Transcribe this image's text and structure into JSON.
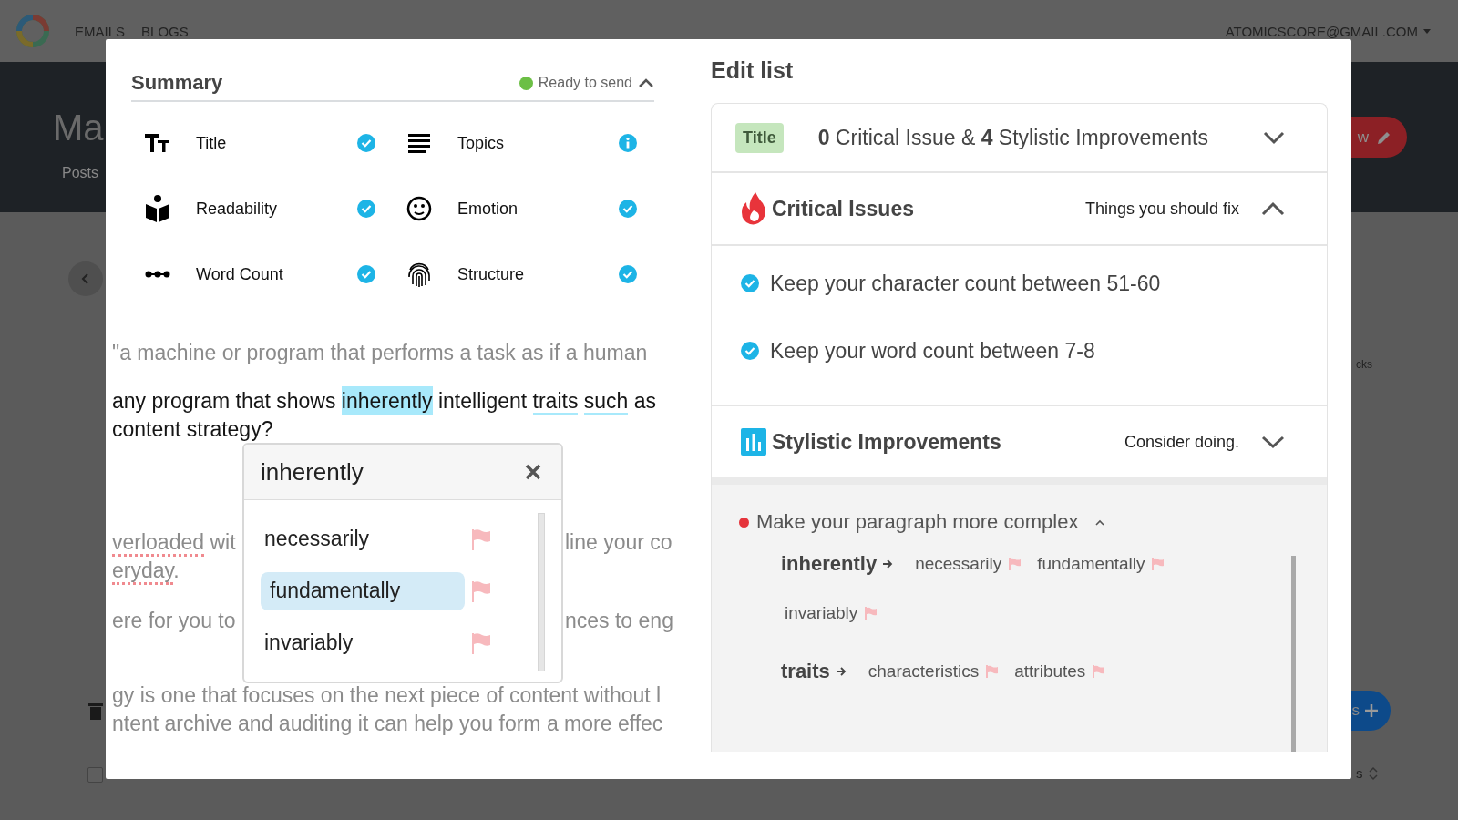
{
  "top_nav": {
    "links": [
      "EMAILS",
      "BLOGS"
    ],
    "account": "ATOMICSCORE@GMAIL.COM"
  },
  "background": {
    "page_title": "Ma",
    "tab": "Posts",
    "button_text": "w",
    "side_text": "cks",
    "add_button_text": "s",
    "table_text": "s",
    "row_checked": false
  },
  "summary": {
    "title": "Summary",
    "status": "Ready to send",
    "expanded": true,
    "items": [
      {
        "label": "Title",
        "kind": "check"
      },
      {
        "label": "Topics",
        "kind": "info"
      },
      {
        "label": "Readability",
        "kind": "check"
      },
      {
        "label": "Emotion",
        "kind": "check"
      },
      {
        "label": "Word Count",
        "kind": "check"
      },
      {
        "label": "Structure",
        "kind": "check"
      }
    ]
  },
  "editor": {
    "paragraphs": [
      {
        "dimmed": true,
        "lines": [
          {
            "parts": [
              {
                "text": "\"a machine or program that performs a task as if a human",
                "kind": "plain"
              }
            ]
          }
        ]
      },
      {
        "dimmed": false,
        "lines": [
          {
            "parts": [
              {
                "text": "any program that shows ",
                "kind": "plain"
              },
              {
                "text": "inherently",
                "kind": "highlight"
              },
              {
                "text": " intelligent ",
                "kind": "plain"
              },
              {
                "text": "traits",
                "kind": "underline"
              },
              {
                "text": "such",
                "kind": "underline"
              },
              {
                "text": " as",
                "kind": "plain"
              }
            ]
          },
          {
            "parts": [
              {
                "text": "content strategy?",
                "kind": "plain"
              }
            ]
          }
        ]
      },
      {
        "dimmed": true,
        "lines": [
          {
            "parts": [
              {
                "text": "verloaded",
                "kind": "dotted"
              },
              {
                "text": " wit",
                "kind": "plain"
              }
            ],
            "right": "line your co"
          },
          {
            "parts": [
              {
                "text": "eryday",
                "kind": "dotted"
              },
              {
                "text": ".",
                "kind": "plain"
              }
            ]
          }
        ]
      },
      {
        "dimmed": true,
        "lines": [
          {
            "parts": [
              {
                "text": "ere for you to",
                "kind": "plain"
              }
            ],
            "right": "nces to eng"
          }
        ]
      },
      {
        "dimmed": true,
        "lines": [
          {
            "parts": [
              {
                "text": "gy is one that focuses on the next piece of content without l",
                "kind": "plain"
              }
            ]
          },
          {
            "parts": [
              {
                "text": "ntent archive and auditing it can help you form a more effec",
                "kind": "plain"
              }
            ]
          }
        ]
      }
    ]
  },
  "popup": {
    "word": "inherently",
    "options": [
      {
        "text": "necessarily",
        "selected": false
      },
      {
        "text": "fundamentally",
        "selected": true
      },
      {
        "text": "invariably",
        "selected": false
      }
    ]
  },
  "edit_list": {
    "title": "Edit list",
    "badge": "Title",
    "summary": "**0** Critical Issue & **4** Stylistic Improvements",
    "expanded": false,
    "sections": [
      {
        "kind": "critical",
        "title": "Critical Issues",
        "hint": "Things you should fix",
        "expanded": true,
        "items": [
          {
            "text": "Keep your character count between 51-60",
            "done": true
          },
          {
            "text": "Keep your word count between 7-8",
            "done": true
          }
        ]
      },
      {
        "kind": "stylistic",
        "title": "Stylistic Improvements",
        "hint": "Consider doing.",
        "expanded": false
      }
    ],
    "suggestion": {
      "text": "Make your paragraph more complex",
      "expanded": true,
      "words": [
        {
          "word": "inherently",
          "alternatives": [
            "necessarily",
            "fundamentally",
            "invariably"
          ]
        },
        {
          "word": "traits",
          "alternatives": [
            "characteristics",
            "attributes"
          ]
        }
      ]
    }
  }
}
